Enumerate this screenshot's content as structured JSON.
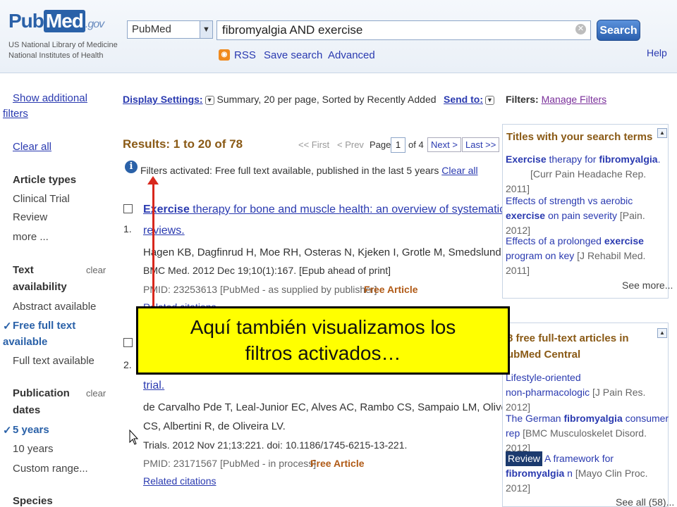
{
  "header": {
    "logo_pub": "Pub",
    "logo_med": "Med",
    "logo_gov": ".gov",
    "org_line1": "US National Library of Medicine",
    "org_line2": "National Institutes of Health",
    "database_selected": "PubMed",
    "search_query": "fibromyalgia AND exercise",
    "search_button": "Search",
    "links": [
      "RSS",
      "Save search",
      "Advanced"
    ],
    "help": "Help"
  },
  "sidebar": {
    "show_additional": "Show additional",
    "filters": "filters",
    "clear_all": "Clear all",
    "article_types": {
      "heading": "Article types",
      "items": [
        "Clinical Trial",
        "Review",
        "more ..."
      ]
    },
    "text_availability": {
      "heading_line1": "Text",
      "heading_line2": "availability",
      "clear": "clear",
      "items": [
        "Abstract available"
      ],
      "selected_line1": "Free full text",
      "selected_line2": "available",
      "after": "Full text available"
    },
    "publication_dates": {
      "heading_line1": "Publication",
      "heading_line2": "dates",
      "clear": "clear",
      "selected": "5 years",
      "items": [
        "10 years",
        "Custom range..."
      ]
    },
    "species": "Species",
    "check_mark": "✓"
  },
  "display": {
    "settings_label": "Display Settings:",
    "settings_value": "Summary, 20 per page, Sorted by Recently Added",
    "send_to": "Send to:"
  },
  "results": {
    "title": "Results: 1 to 20 of 78",
    "first": "<< First",
    "prev": "< Prev",
    "page_label": "Page",
    "page_value": "1",
    "of_pages": "of 4",
    "next": "Next >",
    "last": "Last >>",
    "filters_activated": "Filters activated: Free full text available, published in the last 5 years",
    "clear_all": "Clear all",
    "items": [
      {
        "num": "1.",
        "title_bold": "Exercise",
        "title_rest": " therapy for bone and muscle health: an overview of systematic",
        "title_line2": "reviews.",
        "authors": "Hagen KB, Dagfinrud H, Moe RH, Osteras N, Kjeken I, Grotle M, Smedslund G.",
        "journal": "BMC Med. 2012 Dec 19;10(1):167. [Epub ahead of print]",
        "pmid": "PMID: 23253613 [PubMed - as supplied by publisher]",
        "free": "Free Article",
        "related": "Related citations"
      },
      {
        "num": "2.",
        "title_line2": "trial.",
        "authors_line1": "de Carvalho Pde T, Leal-Junior EC, Alves AC, Rambo CS, Sampaio LM, Oliveira",
        "authors_line2": "CS, Albertini R, de Oliveira LV.",
        "journal": "Trials. 2012 Nov 21;13:221. doi: 10.1186/1745-6215-13-221.",
        "pmid": "PMID: 23171567 [PubMed - in process]",
        "free": "Free Article",
        "related": "Related citations"
      }
    ]
  },
  "right": {
    "filters_label": "Filters:",
    "manage_filters": "Manage Filters",
    "panel1": {
      "title": "Titles with your search terms",
      "items": [
        {
          "line1_bold": "Exercise",
          "line1_rest": " therapy for ",
          "line1_bold2": "fibromyalgia",
          "line1_end": ".",
          "src": "[Curr Pain Headache Rep. 2011]"
        },
        {
          "line1": "Effects of strength vs aerobic",
          "line2_bold": "exercise",
          "line2_rest": " on pain severity",
          "src": "[Pain. 2012]"
        },
        {
          "line1": "Effects of a prolonged ",
          "line1_bold": "exercise",
          "line2": "program on key",
          "src": "[J Rehabil Med. 2011]"
        }
      ],
      "see_more": "See more..."
    },
    "panel2": {
      "title_line1": "8 free full-text articles in",
      "title_line2": "ubMed Central",
      "items": [
        {
          "line1": "Lifestyle-oriented",
          "line2": "non-pharmacologic",
          "src": "[J Pain Res. 2012]"
        },
        {
          "line1": "The German ",
          "line1_bold": "fibromyalgia",
          "line1_end": " consumer",
          "line2": "rep",
          "src": "[BMC Musculoskelet Disord. 2012]"
        },
        {
          "badge": "Review",
          "line1": " A framework for",
          "line2_bold": "fibromyalgia",
          "line2": " n",
          "src": "[Mayo Clin Proc. 2012]"
        }
      ],
      "see_all": "See all (58)..."
    }
  },
  "callout": {
    "line1": "Aquí también visualizamos los",
    "line2": "filtros activados…"
  },
  "colors": {
    "link": "#2a3ab0",
    "results_title": "#8a5a16",
    "free_article": "#b05a16",
    "callout_bg": "#ffff00",
    "arrow": "#d8271c"
  }
}
